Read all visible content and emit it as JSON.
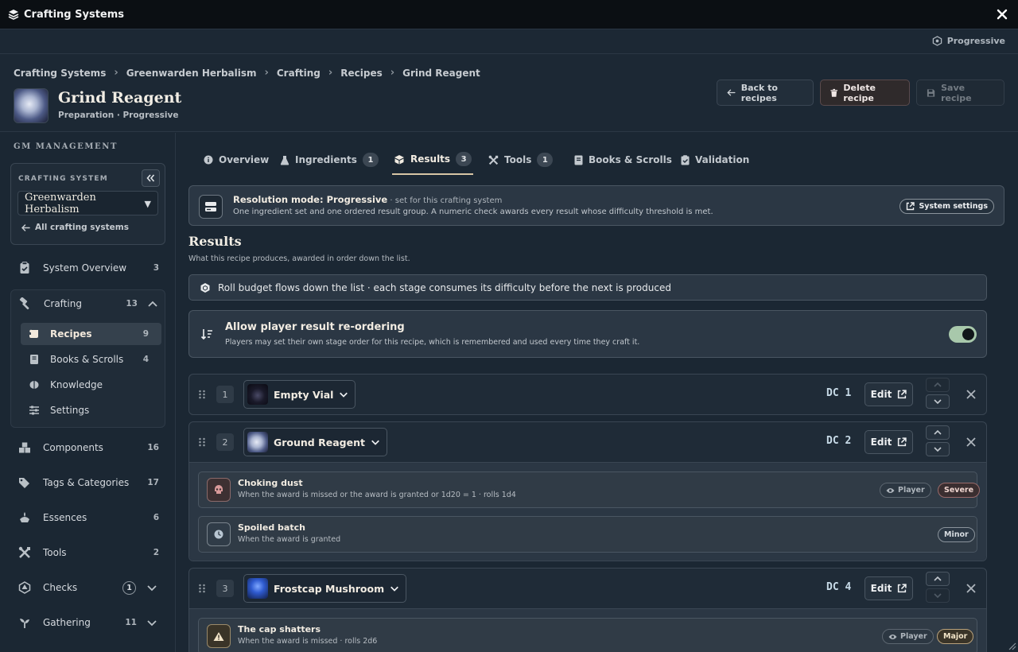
{
  "window": {
    "title": "Crafting Systems",
    "mode": "Progressive"
  },
  "breadcrumb": [
    "Crafting Systems",
    "Greenwarden Herbalism",
    "Crafting",
    "Recipes",
    "Grind Reagent"
  ],
  "recipe": {
    "title": "Grind Reagent",
    "subtitle": "Preparation · Progressive"
  },
  "header_buttons": {
    "back": "Back to recipes",
    "delete": "Delete recipe",
    "save": "Save recipe"
  },
  "sidebar": {
    "section": "GM MANAGEMENT",
    "system_label": "CRAFTING SYSTEM",
    "system_value": "Greenwarden Herbalism",
    "all_link": "All crafting systems",
    "items": [
      {
        "label": "System Overview",
        "count": "3",
        "icon": "clipboard-icon"
      },
      {
        "label": "Crafting",
        "count": "13",
        "icon": "hammer-icon"
      },
      {
        "label": "Components",
        "count": "16",
        "icon": "boxes-icon"
      },
      {
        "label": "Tags & Categories",
        "count": "17",
        "icon": "tags-icon"
      },
      {
        "label": "Essences",
        "count": "6",
        "icon": "essence-icon"
      },
      {
        "label": "Tools",
        "count": "2",
        "icon": "tools-icon"
      },
      {
        "label": "Checks",
        "count": "1",
        "icon": "dice-icon"
      },
      {
        "label": "Gathering",
        "count": "11",
        "icon": "sprout-icon"
      }
    ],
    "crafting_sub": [
      {
        "label": "Recipes",
        "count": "9",
        "icon": "scroll-icon",
        "active": true
      },
      {
        "label": "Books & Scrolls",
        "count": "4",
        "icon": "book-icon"
      },
      {
        "label": "Knowledge",
        "count": "",
        "icon": "brain-icon"
      },
      {
        "label": "Settings",
        "count": "",
        "icon": "sliders-icon"
      }
    ]
  },
  "tabs": [
    {
      "label": "Overview",
      "count": ""
    },
    {
      "label": "Ingredients",
      "count": "1"
    },
    {
      "label": "Results",
      "count": "3"
    },
    {
      "label": "Tools",
      "count": "1"
    },
    {
      "label": "Books & Scrolls",
      "count": ""
    },
    {
      "label": "Validation",
      "count": ""
    }
  ],
  "resolution": {
    "title": "Resolution mode: Progressive",
    "note": " · set for this crafting system",
    "desc": "One ingredient set and one ordered result group. A numeric check awards every result whose difficulty threshold is met.",
    "button": "System settings"
  },
  "results": {
    "heading": "Results",
    "sub": "What this recipe produces, awarded in order down the list.",
    "budget": "Roll budget flows down the list · each stage consumes its difficulty before the next is produced",
    "reorder_title": "Allow player result re-ordering",
    "reorder_desc": "Players may set their own stage order for this recipe, which is remembered and used every time they craft it.",
    "reorder_enabled": true
  },
  "edit_label": "Edit",
  "stages": [
    {
      "num": "1",
      "name": "Empty Vial",
      "dc": "DC 1",
      "consequences": []
    },
    {
      "num": "2",
      "name": "Ground Reagent",
      "dc": "DC 2",
      "consequences": [
        {
          "title": "Choking dust",
          "desc": "When the award is missed or the award is granted or 1d20 = 1 · rolls 1d4",
          "player": "Player",
          "severity": "Severe"
        },
        {
          "title": "Spoiled batch",
          "desc": "When the award is granted",
          "player": "",
          "severity": "Minor"
        }
      ]
    },
    {
      "num": "3",
      "name": "Frostcap Mushroom",
      "dc": "DC 4",
      "consequences": [
        {
          "title": "The cap shatters",
          "desc": "When the award is missed · rolls 2d6",
          "player": "Player",
          "severity": "Major"
        }
      ]
    }
  ]
}
